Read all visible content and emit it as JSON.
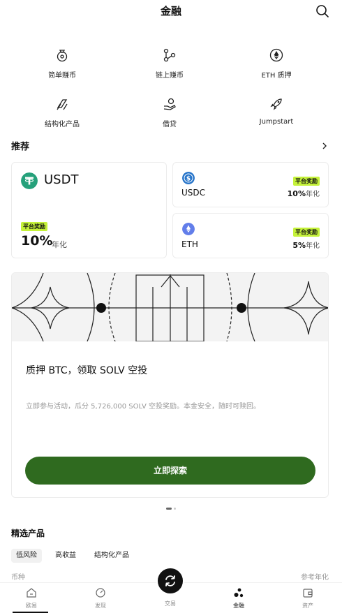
{
  "header": {
    "title": "金融"
  },
  "grid": {
    "items": [
      {
        "label": "简单赚币",
        "icon": "coin-bag-icon"
      },
      {
        "label": "链上赚币",
        "icon": "nodes-icon"
      },
      {
        "label": "ETH 质押",
        "icon": "eth-icon"
      },
      {
        "label": "结构化产品",
        "icon": "structured-icon"
      },
      {
        "label": "借贷",
        "icon": "loan-hand-icon"
      },
      {
        "label": "Jumpstart",
        "icon": "rocket-icon"
      }
    ]
  },
  "recommend": {
    "title": "推荐",
    "usdt": {
      "name": "USDT",
      "badge": "平台奖励",
      "apy": "10%",
      "unit": "年化"
    },
    "usdc": {
      "name": "USDC",
      "badge": "平台奖励",
      "apy": "10%",
      "unit": "年化"
    },
    "eth": {
      "name": "ETH",
      "badge": "平台奖励",
      "apy": "5%",
      "unit": "年化"
    }
  },
  "banner": {
    "title": "质押 BTC，领取 SOLV 空投",
    "desc": "立即参与活动，瓜分 5,726,000 SOLV 空投奖励。本金安全，随时可赎回。",
    "cta": "立即探索"
  },
  "featured": {
    "title": "精选产品",
    "filters": [
      "低风险",
      "高收益",
      "结构化产品"
    ],
    "active_filter": "低风险",
    "col_left": "币种",
    "col_right": "参考年化"
  },
  "tabbar": {
    "tabs": [
      {
        "label": "欧易",
        "icon": "home-icon"
      },
      {
        "label": "发现",
        "icon": "discover-icon"
      },
      {
        "label": "交易",
        "icon": "swap-icon"
      },
      {
        "label": "金融",
        "icon": "finance-icon"
      },
      {
        "label": "资产",
        "icon": "wallet-icon"
      }
    ],
    "active": "金融"
  },
  "colors": {
    "accent_green": "#2f6a1f",
    "badge_lime": "#c5f23a",
    "usdt": "#26a17b",
    "usdc": "#2775ca",
    "eth": "#627eea"
  }
}
